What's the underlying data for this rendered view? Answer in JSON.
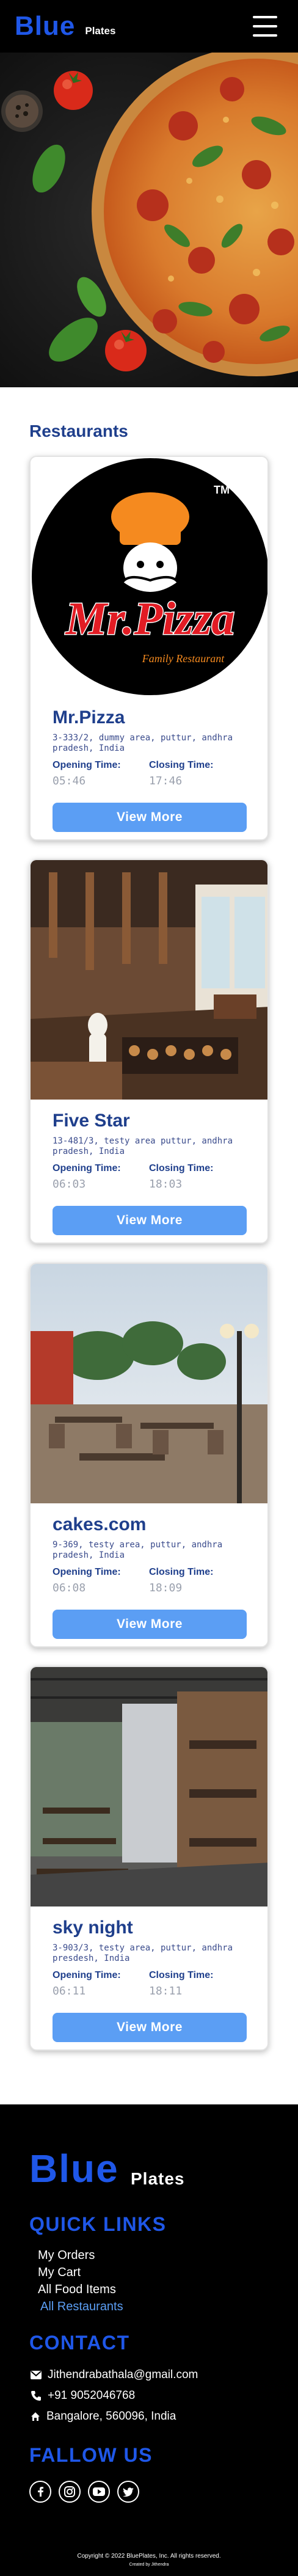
{
  "navbar": {
    "brand": "Blue",
    "brand_sub": "Plates"
  },
  "page": {
    "section_title": "Restaurants"
  },
  "labels": {
    "opening": "Opening Time:",
    "closing": "Closing Time:",
    "view_more": "View More"
  },
  "restaurants": [
    {
      "name": "Mr.Pizza",
      "address": "3-333/2, dummy area, puttur, andhra pradesh, India",
      "opening": "05:46",
      "closing": "17:46",
      "logo_text": "Mr.Pizza",
      "logo_tagline": "Family Restaurant",
      "logo_tm": "TM"
    },
    {
      "name": "Five Star",
      "address": "13-481/3, testy area puttur, andhra pradesh, India",
      "opening": "06:03",
      "closing": "18:03"
    },
    {
      "name": "cakes.com",
      "address": "9-369, testy area, puttur, andhra pradesh, India",
      "opening": "06:08",
      "closing": "18:09"
    },
    {
      "name": "sky night",
      "address": "3-903/3, testy area, puttur, andhra presdesh, India",
      "opening": "06:11",
      "closing": "18:11"
    }
  ],
  "footer": {
    "brand": "Blue",
    "brand_sub": "Plates",
    "quick_links_title": "QUICK LINKS",
    "links": [
      "My Orders",
      "My Cart",
      "All Food Items",
      "All Restaurants"
    ],
    "contact_title": "CONTACT",
    "email": "Jithendrabathala@gmail.com",
    "phone": "+91 9052046768",
    "address": "Bangalore, 560096, India",
    "follow_title": "FALLOW US",
    "social_icons": [
      "facebook-icon",
      "instagram-icon",
      "youtube-icon",
      "twitter-icon"
    ],
    "copyright": "Copyright © 2022 BluePlates, Inc. All rights reserved.",
    "created_by": "Created by Jithendra"
  },
  "colors": {
    "brand": "#1f57e8",
    "heading": "#1f3f8c",
    "button": "#5b9ef4",
    "footer_bg": "#000000"
  }
}
